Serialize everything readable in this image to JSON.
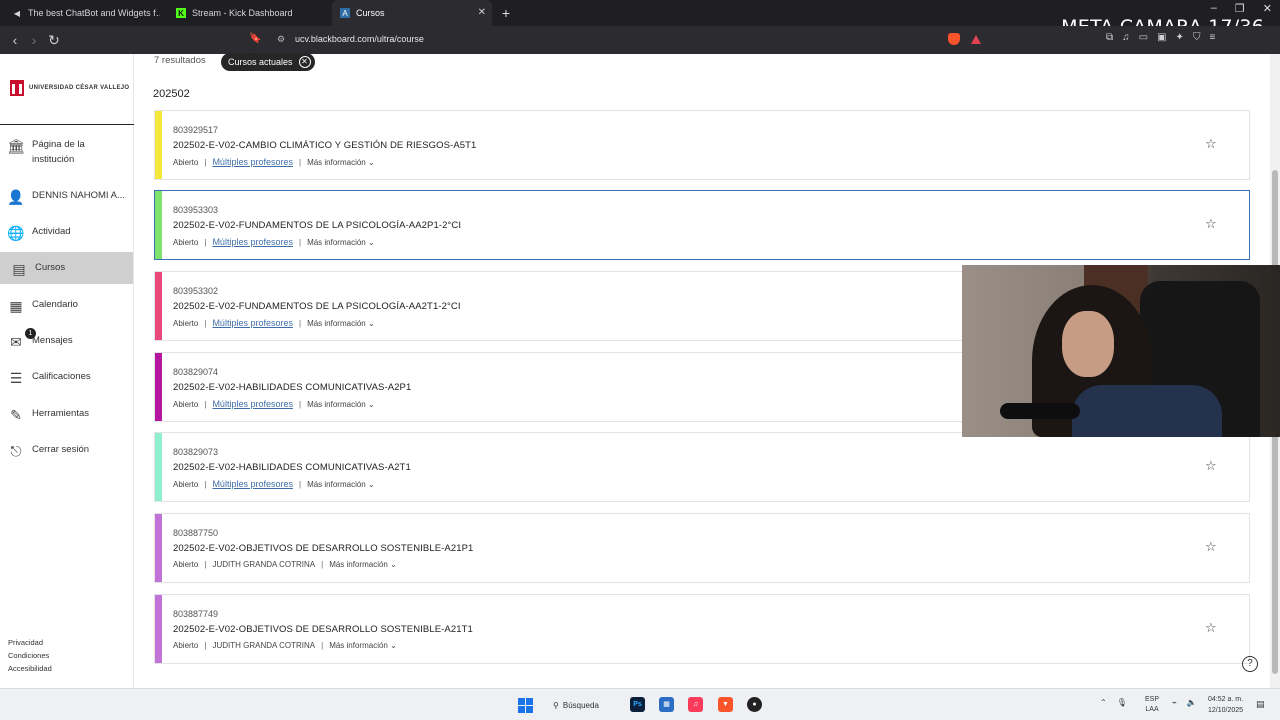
{
  "browser": {
    "tabs": [
      {
        "title": "The best ChatBot and Widgets f…",
        "icon": "audio-icon"
      },
      {
        "title": "Stream - Kick Dashboard",
        "icon": "kick-icon"
      },
      {
        "title": "Cursos",
        "icon": "blackboard-icon",
        "active": true
      }
    ],
    "url": "ucv.blackboard.com/ultra/course",
    "overlay_title": "META CAMARA 17/36"
  },
  "sidebar": {
    "logo_text": "UNIVERSIDAD CÉSAR VALLEJO",
    "items": [
      {
        "label": "Página de la institución",
        "icon": "institution-icon"
      },
      {
        "label": "DENNIS NAHOMI A...",
        "icon": "user-icon"
      },
      {
        "label": "Actividad",
        "icon": "globe-icon"
      },
      {
        "label": "Cursos",
        "icon": "courses-icon",
        "active": true
      },
      {
        "label": "Calendario",
        "icon": "calendar-icon"
      },
      {
        "label": "Mensajes",
        "icon": "mail-icon",
        "badge": "1"
      },
      {
        "label": "Calificaciones",
        "icon": "grades-icon"
      },
      {
        "label": "Herramientas",
        "icon": "tools-icon"
      },
      {
        "label": "Cerrar sesión",
        "icon": "logout-icon"
      }
    ],
    "footer": [
      "Privacidad",
      "Condiciones",
      "Accesibilidad"
    ]
  },
  "main": {
    "results": "7 resultados",
    "filter_chip": "Cursos actuales",
    "term": "202502",
    "courses": [
      {
        "id": "803929517",
        "name": "202502-E-V02-CAMBIO CLIMÁTICO Y GESTIÓN DE RIESGOS-A5T1",
        "status": "Abierto",
        "instructor": "Múltiples profesores",
        "more": "Más información",
        "color": "#f4e83b"
      },
      {
        "id": "803953303",
        "name": "202502-E-V02-FUNDAMENTOS DE LA PSICOLOGÍA-AA2P1-2°CI",
        "status": "Abierto",
        "instructor": "Múltiples profesores",
        "more": "Más información",
        "color": "#7de36b"
      },
      {
        "id": "803953302",
        "name": "202502-E-V02-FUNDAMENTOS DE LA PSICOLOGÍA-AA2T1-2°CI",
        "status": "Abierto",
        "instructor": "Múltiples profesores",
        "more": "Más información",
        "color": "#e8497a"
      },
      {
        "id": "803829074",
        "name": "202502-E-V02-HABILIDADES COMUNICATIVAS-A2P1",
        "status": "Abierto",
        "instructor": "Múltiples profesores",
        "more": "Más información",
        "color": "#b5179e"
      },
      {
        "id": "803829073",
        "name": "202502-E-V02-HABILIDADES COMUNICATIVAS-A2T1",
        "status": "Abierto",
        "instructor": "Múltiples profesores",
        "more": "Más información",
        "color": "#8ef0d0"
      },
      {
        "id": "803887750",
        "name": "202502-E-V02-OBJETIVOS DE DESARROLLO SOSTENIBLE-A21P1",
        "status": "Abierto",
        "instructor": "JUDITH GRANDA COTRINA",
        "more": "Más información",
        "color": "#c174d8"
      },
      {
        "id": "803887749",
        "name": "202502-E-V02-OBJETIVOS DE DESARROLLO SOSTENIBLE-A21T1",
        "status": "Abierto",
        "instructor": "JUDITH GRANDA COTRINA",
        "more": "Más información",
        "color": "#c174d8"
      }
    ]
  },
  "taskbar": {
    "search_label": "Búsqueda",
    "lang": [
      "ESP",
      "LAA"
    ],
    "time": "04:52 a. m.",
    "date": "12/10/2025"
  }
}
